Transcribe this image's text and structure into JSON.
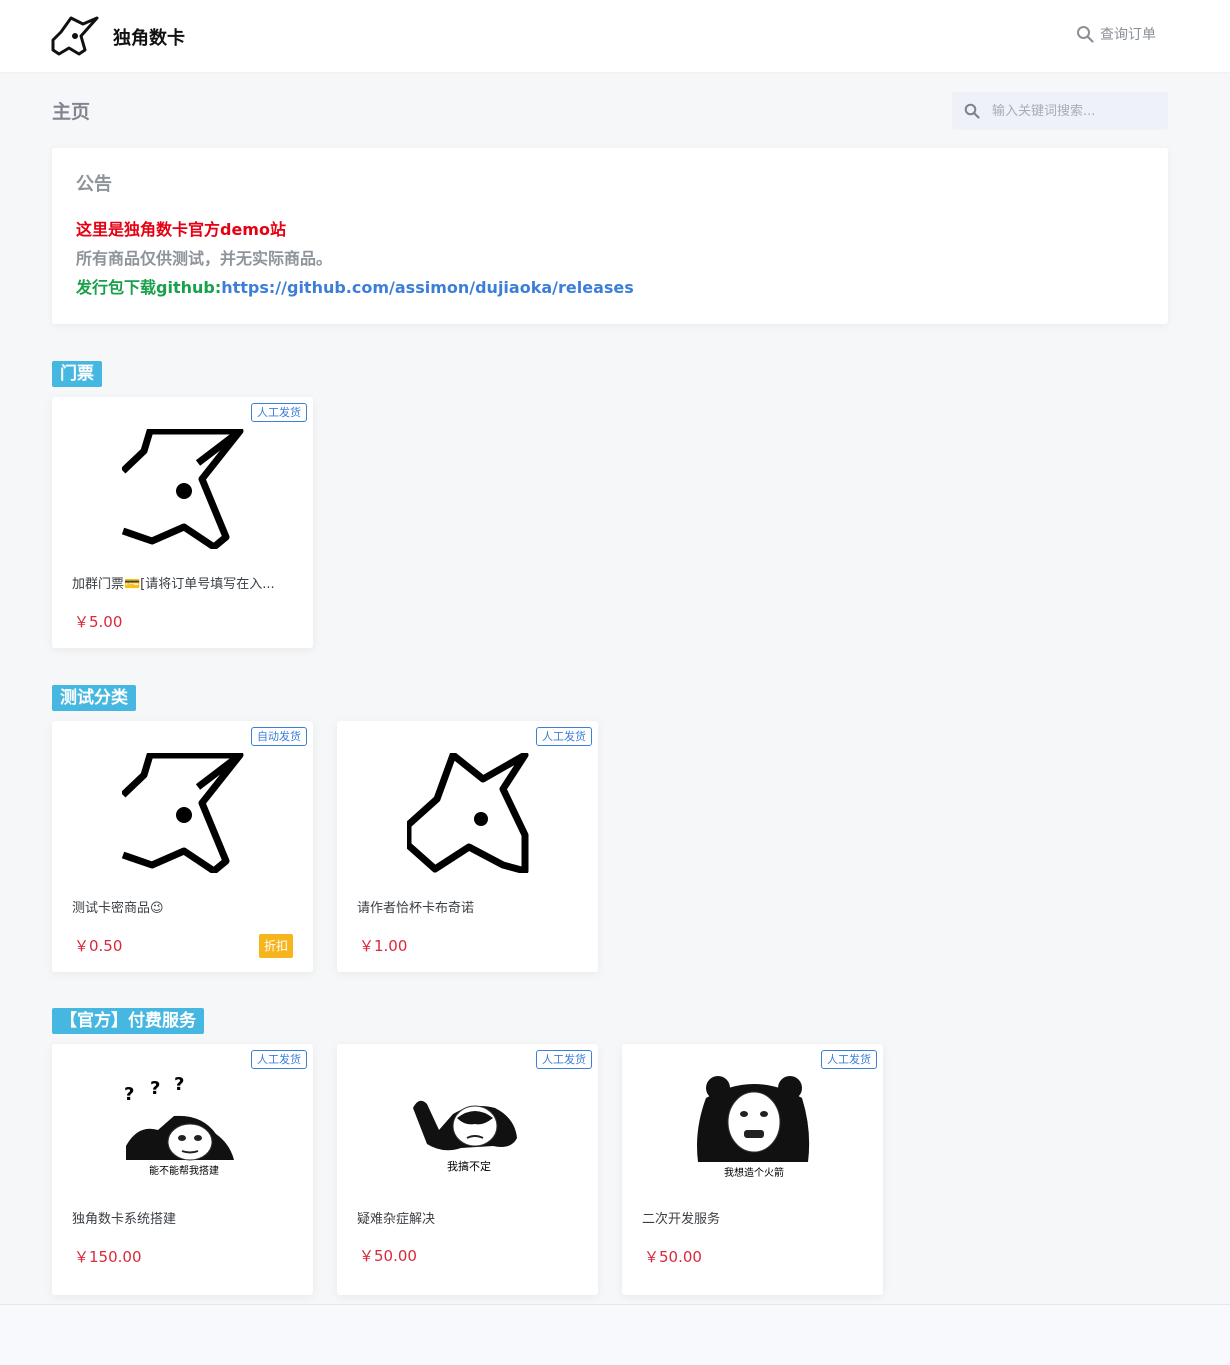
{
  "header": {
    "brand": "独角数卡",
    "order_link": "查询订单"
  },
  "page": {
    "title": "主页",
    "search_placeholder": "输入关键词搜索..."
  },
  "notice": {
    "title": "公告",
    "line1": "这里是独角数卡官方demo站",
    "line2": "所有商品仅供测试，并无实际商品。",
    "line3_prefix": "发行包下载github:",
    "line3_link": "https://github.com/assimon/dujiaoka/releases"
  },
  "categories": [
    {
      "label": "门票",
      "items": [
        {
          "name": "加群门票💳[请将订单号填写在入...",
          "price": "￥5.00",
          "tag": "人工发货",
          "image": "unicorn-logo"
        }
      ]
    },
    {
      "label": "测试分类",
      "items": [
        {
          "name": "测试卡密商品😉",
          "price": "￥0.50",
          "tag": "自动发货",
          "discount": "折扣",
          "image": "unicorn-logo"
        },
        {
          "name": "请作者恰杯卡布奇诺",
          "price": "￥1.00",
          "tag": "人工发货",
          "image": "unicorn-logo"
        }
      ]
    },
    {
      "label": "【官方】付费服务",
      "items": [
        {
          "name": "独角数卡系统搭建",
          "price": "￥150.00",
          "tag": "人工发货",
          "image": "panda-meme",
          "caption": "能不能帮我搭建"
        },
        {
          "name": "疑难杂症解决",
          "price": "￥50.00",
          "tag": "人工发货",
          "image": "panda-meme",
          "caption": "我搞不定"
        },
        {
          "name": "二次开发服务",
          "price": "￥50.00",
          "tag": "人工发货",
          "image": "panda-meme",
          "caption": "我想造个火箭"
        }
      ]
    }
  ],
  "colors": {
    "accent_blue": "#3d7fd8",
    "category_label": "#46b7e0",
    "price_red": "#d9293a",
    "notice_red": "#e60012",
    "notice_green": "#18a04a",
    "discount_orange": "#f6b51d"
  }
}
